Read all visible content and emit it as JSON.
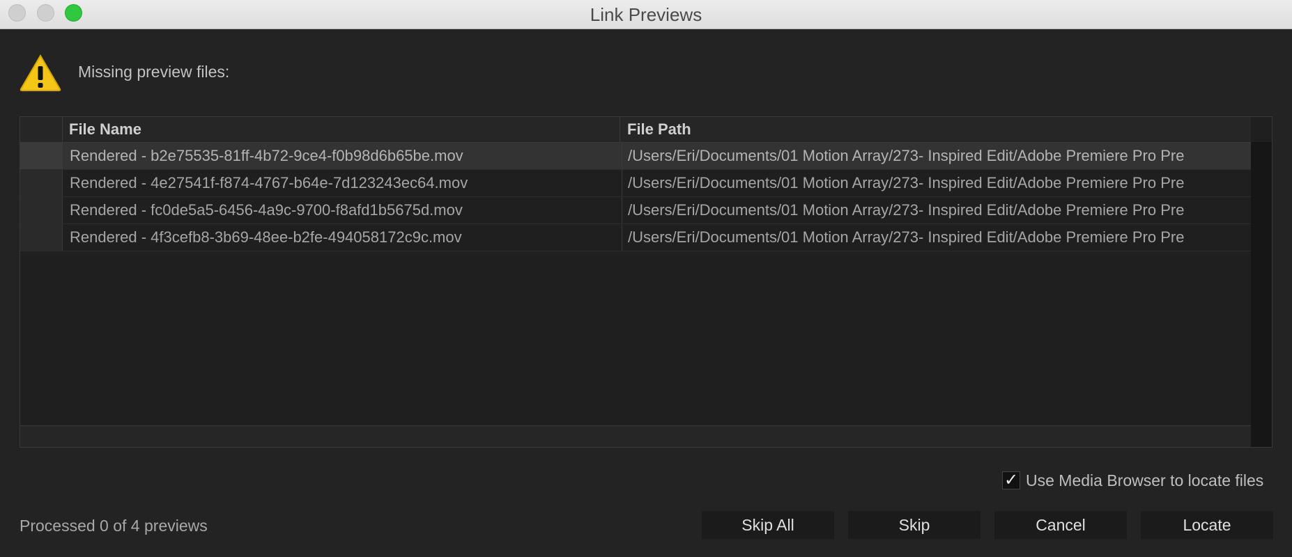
{
  "window": {
    "title": "Link Previews"
  },
  "message": "Missing preview files:",
  "table": {
    "headers": {
      "file_name": "File Name",
      "file_path": "File Path"
    },
    "rows": [
      {
        "name": "Rendered - b2e75535-81ff-4b72-9ce4-f0b98d6b65be.mov",
        "path": "/Users/Eri/Documents/01 Motion Array/273- Inspired Edit/Adobe Premiere Pro Pre"
      },
      {
        "name": "Rendered - 4e27541f-f874-4767-b64e-7d123243ec64.mov",
        "path": "/Users/Eri/Documents/01 Motion Array/273- Inspired Edit/Adobe Premiere Pro Pre"
      },
      {
        "name": "Rendered - fc0de5a5-6456-4a9c-9700-f8afd1b5675d.mov",
        "path": "/Users/Eri/Documents/01 Motion Array/273- Inspired Edit/Adobe Premiere Pro Pre"
      },
      {
        "name": "Rendered - 4f3cefb8-3b69-48ee-b2fe-494058172c9c.mov",
        "path": "/Users/Eri/Documents/01 Motion Array/273- Inspired Edit/Adobe Premiere Pro Pre"
      }
    ]
  },
  "options": {
    "media_browser_label": "Use Media Browser to locate files",
    "media_browser_checked": true,
    "check_glyph": "✓"
  },
  "status": "Processed 0 of 4 previews",
  "buttons": {
    "skip_all": "Skip All",
    "skip": "Skip",
    "cancel": "Cancel",
    "locate": "Locate"
  },
  "icons": {
    "warning": "warning-triangle-icon"
  },
  "colors": {
    "warning_yellow": "#f5c518",
    "close_dot": "#cfcfcf",
    "zoom_dot": "#2fc83f"
  }
}
